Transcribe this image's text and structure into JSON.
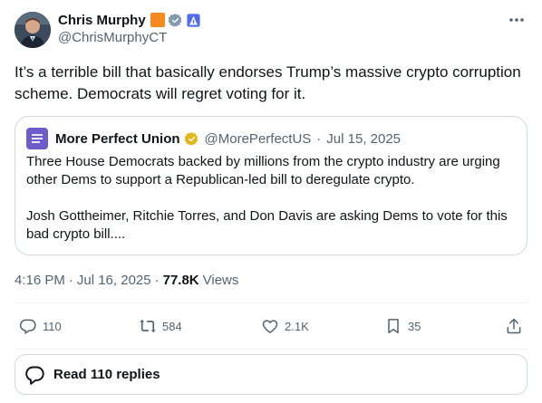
{
  "author": {
    "name": "Chris Murphy",
    "handle": "@ChrisMurphyCT",
    "badges": [
      "orange-square-icon",
      "verified-badge-icon",
      "capitol-building-icon"
    ]
  },
  "post": {
    "text": "It’s a terrible bill that basically endorses Trump’s massive crypto corruption scheme. Democrats will regret voting for it."
  },
  "quoted_post": {
    "name": "More Perfect Union",
    "handle": "@MorePerfectUS",
    "separator": "·",
    "date": "Jul 15, 2025",
    "paragraphs": [
      "Three House Democrats backed by millions from the crypto industry are urging other Dems to support a Republican-led bill to deregulate crypto.",
      "Josh Gottheimer, Ritchie Torres, and Don Davis are asking Dems to vote for this bad crypto bill...."
    ]
  },
  "meta": {
    "time": "4:16 PM",
    "separator": "·",
    "date": "Jul 16, 2025",
    "views_count": "77.8K",
    "views_label": "Views"
  },
  "actions": {
    "replies": "110",
    "reposts": "584",
    "likes": "2.1K",
    "bookmarks": "35"
  },
  "read_replies": {
    "label": "Read 110 replies"
  },
  "colors": {
    "text": "#0f1419",
    "muted": "#536471",
    "border": "#cfd9de",
    "verified": "#829aab",
    "gold": "#e2b719"
  }
}
